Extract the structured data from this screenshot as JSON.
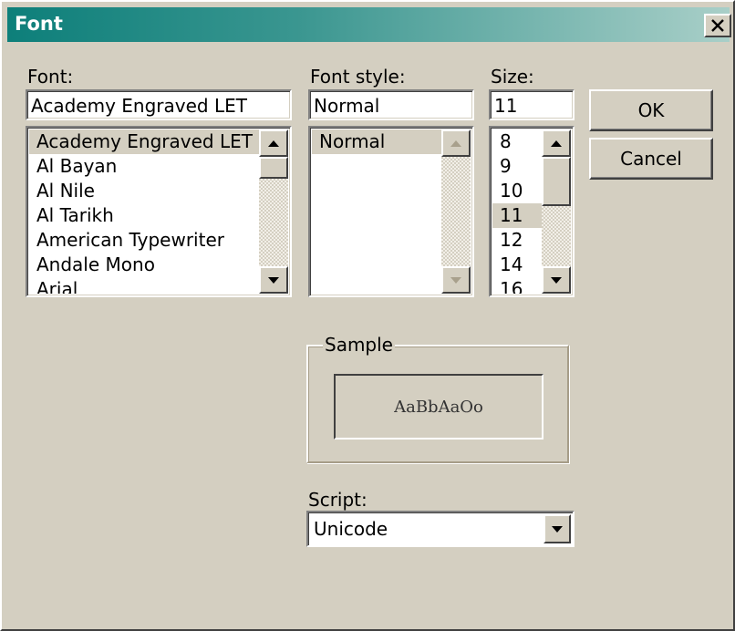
{
  "window": {
    "title": "Font",
    "close_symbol": "✕"
  },
  "font": {
    "label": "Font:",
    "value": "Academy Engraved LET",
    "items": [
      "Academy Engraved LET",
      "Al Bayan",
      "Al Nile",
      "Al Tarikh",
      "American Typewriter",
      "Andale Mono",
      "Arial"
    ],
    "selected_index": 0
  },
  "style": {
    "label": "Font style:",
    "value": "Normal",
    "items": [
      "Normal"
    ],
    "selected_index": 0
  },
  "size": {
    "label": "Size:",
    "value": "11",
    "items": [
      "8",
      "9",
      "10",
      "11",
      "12",
      "14",
      "16"
    ],
    "selected_index": 3
  },
  "buttons": {
    "ok": "OK",
    "cancel": "Cancel"
  },
  "sample": {
    "label": "Sample",
    "text": "AaBbAaOo"
  },
  "script": {
    "label": "Script:",
    "value": "Unicode"
  },
  "icons": {
    "scroll_up": "triangle-up-icon",
    "scroll_down": "triangle-down-icon",
    "combo": "chevron-down-icon",
    "close": "close-icon"
  }
}
